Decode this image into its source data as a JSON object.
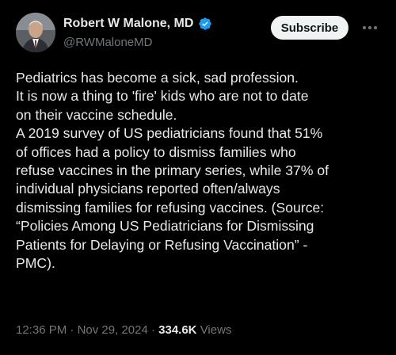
{
  "author": {
    "display_name": "Robert W Malone, MD",
    "handle": "@RWMaloneMD",
    "verified": true,
    "verified_color": "#1d9bf0"
  },
  "actions": {
    "subscribe_label": "Subscribe"
  },
  "post": {
    "lines": [
      "Pediatrics has become a sick, sad profession.",
      "It is now a thing to 'fire' kids who are not  to date",
      "on their vaccine schedule.",
      "A 2019 survey of US pediatricians found that 51%",
      "of offices had a policy to dismiss families who",
      "refuse vaccines in the primary series, while 37% of",
      "individual physicians reported often/always",
      "dismissing families for refusing vaccines. (Source:",
      "“Policies Among US Pediatricians for Dismissing",
      "Patients for Delaying or Refusing Vaccination” -",
      "PMC)."
    ]
  },
  "meta": {
    "time": "12:36 PM",
    "separator": "·",
    "date": "Nov 29, 2024",
    "views_count": "334.6K",
    "views_label": "Views"
  },
  "colors": {
    "background": "#000000",
    "text_primary": "#e7e9ea",
    "text_secondary": "#71767b",
    "button_bg": "#eff3f4",
    "button_text": "#0f1419"
  }
}
